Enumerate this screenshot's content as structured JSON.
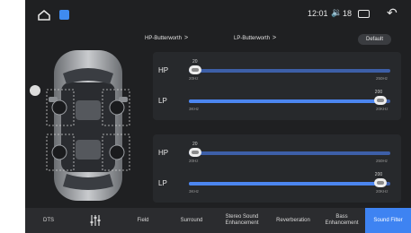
{
  "status_bar": {
    "time": "12:01",
    "volume_level": "18",
    "icons": [
      "home-icon",
      "app-icon",
      "volume-icon",
      "window-icon",
      "back-icon"
    ]
  },
  "filters": {
    "left_dropdown": "HP-Butterworth",
    "right_dropdown": "LP-Butterworth",
    "default_label": "Default"
  },
  "panels": [
    {
      "hp": {
        "label": "HP",
        "value": "20",
        "min": "20Hz",
        "max": "250Hz",
        "level": 0.0
      },
      "lp": {
        "label": "LP",
        "value": "200",
        "min": "3KHz",
        "max": "20KHz",
        "level": 0.95
      }
    },
    {
      "hp": {
        "label": "HP",
        "value": "20",
        "min": "20Hz",
        "max": "250Hz",
        "level": 0.0
      },
      "lp": {
        "label": "LP",
        "value": "200",
        "min": "3KHz",
        "max": "20KHz",
        "level": 0.95
      }
    }
  ],
  "tabs": [
    {
      "label": "DTS",
      "active": false
    },
    {
      "label": "",
      "icon": "equalizer-icon",
      "active": false
    },
    {
      "label": "Field",
      "active": false
    },
    {
      "label": "Surround",
      "active": false
    },
    {
      "label": "Stereo Sound Enhancement",
      "active": false
    },
    {
      "label": "Reverberation",
      "active": false
    },
    {
      "label": "Bass Enhancement",
      "active": false
    },
    {
      "label": "Sound Filter",
      "active": true
    }
  ],
  "colors": {
    "accent": "#4c86f0",
    "active_tab": "#3e83f2",
    "background": "#1f2022",
    "panel": "#27292c"
  }
}
